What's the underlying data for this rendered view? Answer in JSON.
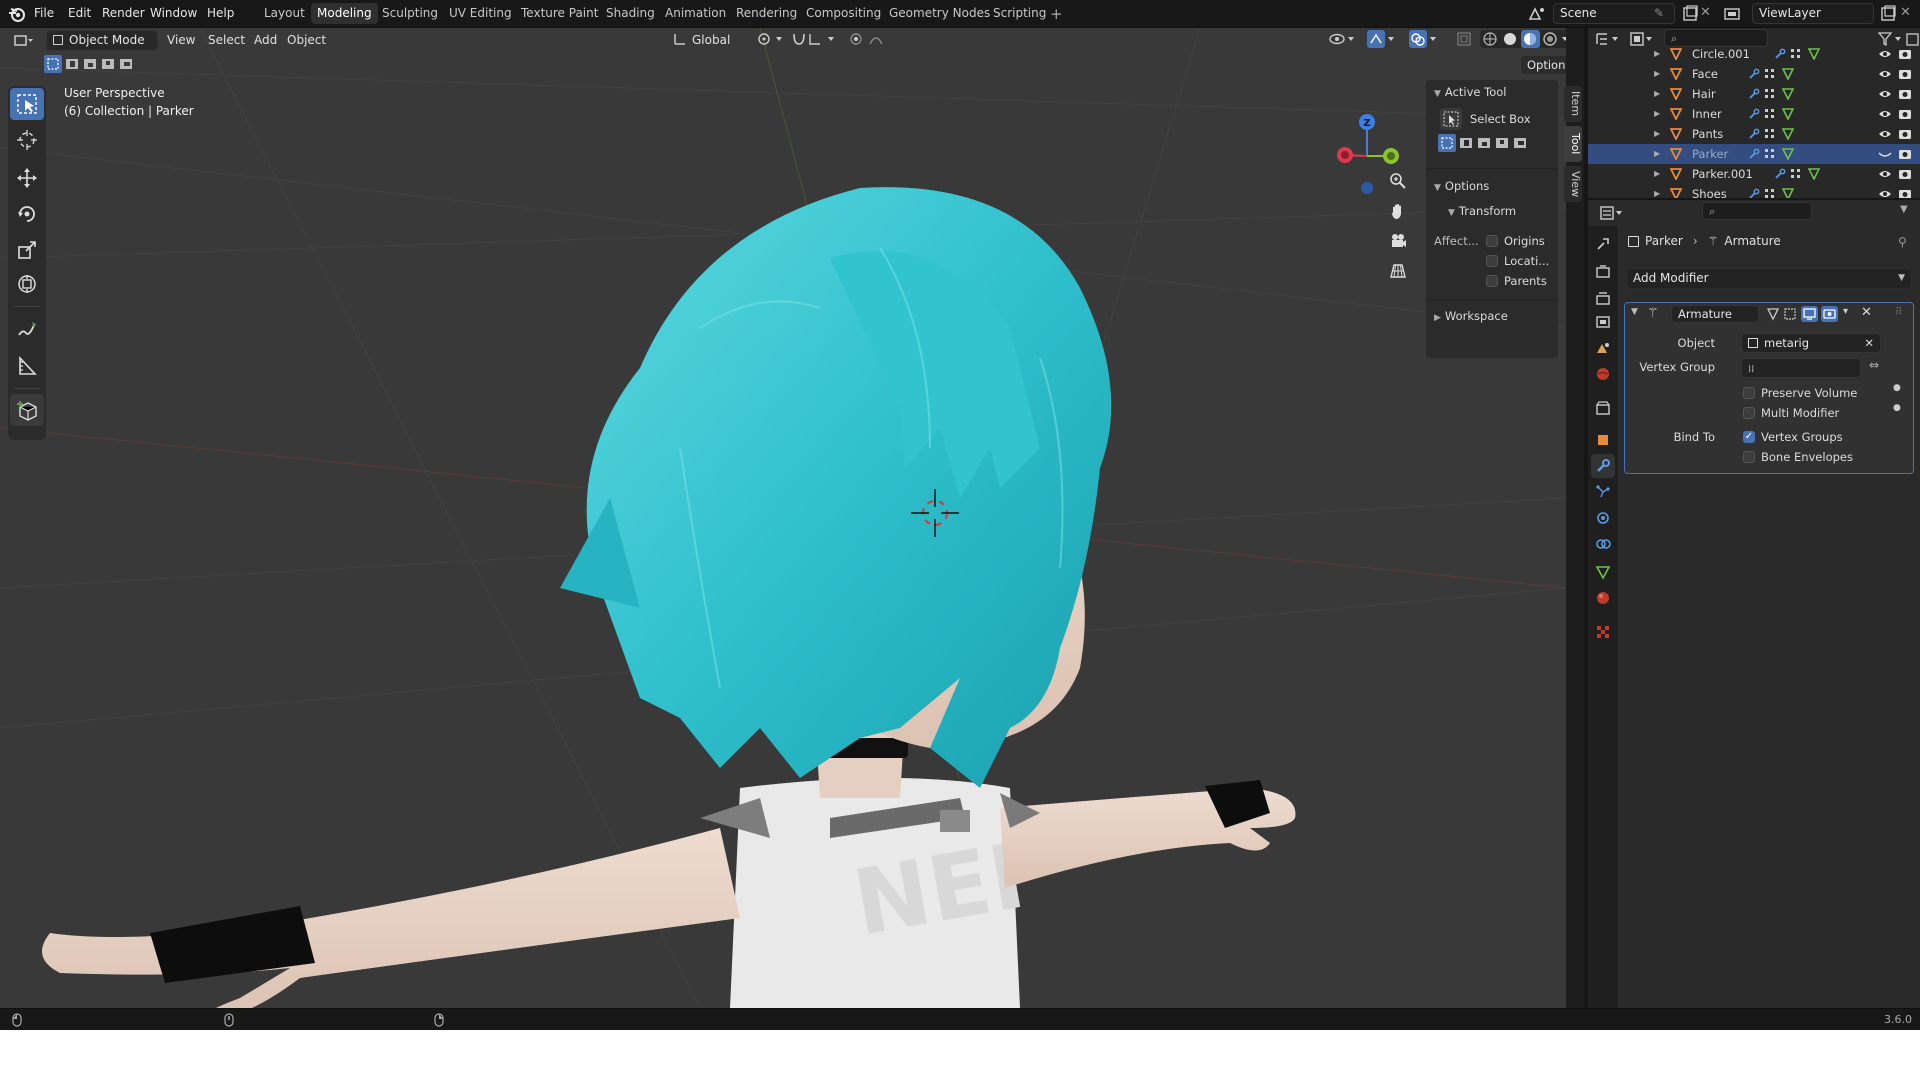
{
  "topbar": {
    "menus": [
      "File",
      "Edit",
      "Render",
      "Window",
      "Help"
    ],
    "workspaces": [
      "Layout",
      "Modeling",
      "Sculpting",
      "UV Editing",
      "Texture Paint",
      "Shading",
      "Animation",
      "Rendering",
      "Compositing",
      "Geometry Nodes",
      "Scripting"
    ],
    "active_workspace": "Modeling",
    "scene": "Scene",
    "view_layer": "ViewLayer"
  },
  "viewport": {
    "mode": "Object Mode",
    "menus": [
      "View",
      "Select",
      "Add",
      "Object"
    ],
    "orientation": "Global",
    "options_label": "Options",
    "overlay_title": "User Perspective",
    "overlay_collection": "(6) Collection | Parker",
    "gizmo_axes": {
      "z": "Z",
      "x": "X",
      "y": "Y"
    },
    "colors": {
      "x": "#e0384e",
      "y": "#8bc22f",
      "z": "#3b80e6",
      "bg": "#393939",
      "hair": "#38c5cf",
      "skin": "#e7d3c6"
    }
  },
  "npanel": {
    "tabs": [
      "Item",
      "Tool",
      "View"
    ],
    "active_tool_header": "Active Tool",
    "active_tool": "Select Box",
    "options_header": "Options",
    "transform_header": "Transform",
    "affect_label": "Affect...",
    "affect_options": [
      "Origins",
      "Locati...",
      "Parents"
    ],
    "workspace_header": "Workspace"
  },
  "outliner": {
    "items": [
      {
        "name": "Circle.001",
        "selected": false
      },
      {
        "name": "Face",
        "selected": false
      },
      {
        "name": "Hair",
        "selected": false
      },
      {
        "name": "Inner",
        "selected": false
      },
      {
        "name": "Pants",
        "selected": false
      },
      {
        "name": "Parker",
        "selected": true
      },
      {
        "name": "Parker.001",
        "selected": false
      },
      {
        "name": "Shoes",
        "selected": false
      }
    ]
  },
  "properties": {
    "breadcrumb_object": "Parker",
    "breadcrumb_modifier": "Armature",
    "add_modifier": "Add Modifier",
    "modifier_name": "Armature",
    "object_label": "Object",
    "object_value": "metarig",
    "vertex_group_label": "Vertex Group",
    "preserve_volume": "Preserve Volume",
    "multi_modifier": "Multi Modifier",
    "bind_to_label": "Bind To",
    "vertex_groups": "Vertex Groups",
    "bone_envelopes": "Bone Envelopes"
  },
  "statusbar": {
    "version": "3.6.0"
  }
}
